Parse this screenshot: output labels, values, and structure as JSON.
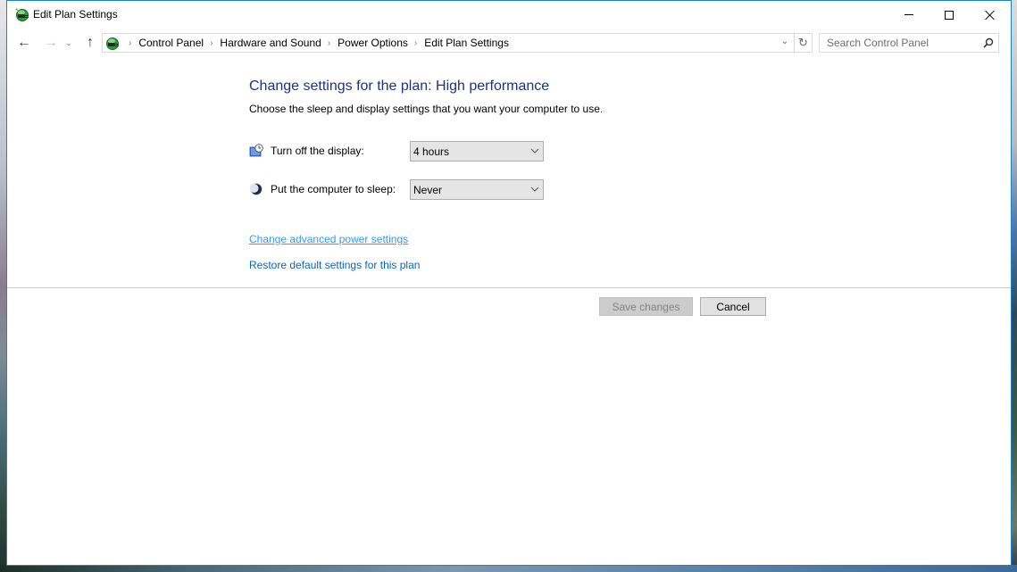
{
  "window": {
    "title": "Edit Plan Settings",
    "icon": "power-options-icon",
    "controls": {
      "minimize": "minimize-icon",
      "maximize": "maximize-icon",
      "close": "close-icon"
    }
  },
  "navigation": {
    "back_icon": "←",
    "forward_icon": "→",
    "recent_icon": "⌄",
    "up_icon": "↑",
    "breadcrumb": [
      {
        "label": "Control Panel"
      },
      {
        "label": "Hardware and Sound"
      },
      {
        "label": "Power Options"
      },
      {
        "label": "Edit Plan Settings"
      }
    ],
    "separator": "›",
    "dropdown_icon": "⌄",
    "refresh_icon": "↻",
    "search": {
      "placeholder": "Search Control Panel",
      "value": ""
    }
  },
  "main": {
    "heading": "Change settings for the plan: High performance",
    "subheading": "Choose the sleep and display settings that you want your computer to use.",
    "settings": [
      {
        "label": "Turn off the display:",
        "value": "4 hours",
        "icon": "display-clock-icon"
      },
      {
        "label": "Put the computer to sleep:",
        "value": "Never",
        "icon": "sleep-moon-icon"
      }
    ],
    "links": {
      "advanced": "Change advanced power settings",
      "restore": "Restore default settings for this plan"
    },
    "buttons": {
      "save": "Save changes",
      "cancel": "Cancel"
    }
  },
  "colors": {
    "heading": "#1e3287",
    "link": "#0066cc",
    "link_hover": "#3399ff",
    "window_border": "#1883d7"
  }
}
